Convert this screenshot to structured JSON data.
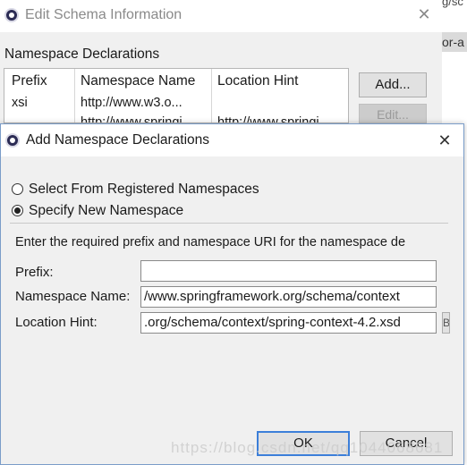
{
  "background_window": {
    "title": "Edit Schema Information",
    "section_label": "Namespace Declarations",
    "columns": [
      "Prefix",
      "Namespace Name",
      "Location Hint"
    ],
    "rows": [
      [
        "xsi",
        "http://www.w3.o...",
        ""
      ],
      [
        "",
        "http://www.springi...",
        "http://www.springi..."
      ]
    ],
    "add_button": "Add...",
    "edit_button": "Edit...",
    "right_edge_text_1": "g/sc",
    "right_edge_tab": "or-a"
  },
  "dialog": {
    "title": "Add Namespace Declarations",
    "radio_registered": "Select From Registered Namespaces",
    "radio_new": "Specify New Namespace",
    "selected_option": "Specify New Namespace",
    "instruction": "Enter the required prefix and namespace URI for the namespace de",
    "prefix_label": "Prefix:",
    "prefix_value": "",
    "namespace_label": "Namespace Name:",
    "namespace_value": "/www.springframework.org/schema/context",
    "location_label": "Location Hint:",
    "location_value": ".org/schema/context/spring-context-4.2.xsd",
    "browse_stub": "B",
    "ok_button": "OK",
    "cancel_button": "Cancel"
  },
  "watermark": "https://blog.csdn.net/qq1044068681",
  "colors": {
    "dialog_bg": "#f0f0f0",
    "default_button_border": "#3c7fd9",
    "title_bg": "#ffffff"
  },
  "icons": [
    "eclipse-app-icon",
    "close-icon"
  ]
}
